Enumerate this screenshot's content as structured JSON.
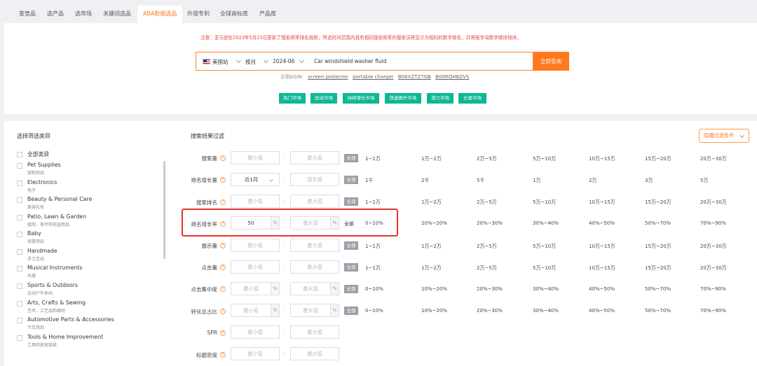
{
  "tabs": [
    {
      "label": "查竞品",
      "active": false
    },
    {
      "label": "选产品",
      "active": false
    },
    {
      "label": "选市场",
      "active": false
    },
    {
      "label": "关键词选品",
      "active": false
    },
    {
      "label": "ABA数据选品",
      "active": true
    },
    {
      "label": "外观专利",
      "active": false
    },
    {
      "label": "全球商标库",
      "active": false
    },
    {
      "label": "产品库",
      "active": false
    }
  ],
  "notice": "注意：亚马逊在2023年5月23日更新了搜索频率排名规则，所选时间范围内具有相同搜索频率的搜索词将显示为相同的数字排名，并将按字母数字顺序排序。",
  "search": {
    "site": "美国站",
    "period": "按月",
    "month": "2024-06",
    "query": "Car windshield washer fluid",
    "button": "立即查询"
  },
  "examples": {
    "label": "示例ASIN:",
    "items": [
      "screen protector",
      "portable charger",
      "B06XZTZ7GB",
      "B00RQHBZVS"
    ]
  },
  "markets": [
    "热门市场",
    "异动市场",
    "持续增长市场",
    "快速飙升市场",
    "潜力市场",
    "长尾市场"
  ],
  "categories": {
    "title": "选择筛选类目",
    "all": "全部类目",
    "items": [
      {
        "en": "Pet Supplies",
        "zh": "宠物用品"
      },
      {
        "en": "Electronics",
        "zh": "电子"
      },
      {
        "en": "Beauty & Personal Care",
        "zh": "美容化妆"
      },
      {
        "en": "Patio, Lawn & Garden",
        "zh": "庭院、草坪和花园用品"
      },
      {
        "en": "Baby",
        "zh": "母婴用品"
      },
      {
        "en": "Handmade",
        "zh": "手工艺品"
      },
      {
        "en": "Musical Instruments",
        "zh": "乐器"
      },
      {
        "en": "Sports & Outdoors",
        "zh": "运动户外休闲"
      },
      {
        "en": "Arts, Crafts & Sewing",
        "zh": "艺术、工艺品和缝纫"
      },
      {
        "en": "Automotive Parts & Accessories",
        "zh": "汽车用品"
      },
      {
        "en": "Tools & Home Improvement",
        "zh": "工具和家居装修"
      }
    ]
  },
  "filter": {
    "title": "搜索结果过滤",
    "hide_button": "隐藏过滤条件",
    "help_icon": "?",
    "min_placeholder": "最小值",
    "max_placeholder": "最大值",
    "all_label": "全部",
    "pct": "%",
    "tilde": "-",
    "rows": [
      {
        "label": "搜索量",
        "min": "",
        "pct": false,
        "options": [
          "1~1万",
          "1万~2万",
          "2万~5万",
          "5万~10万",
          "10万~15万",
          "15万~20万",
          "20万~30万"
        ]
      },
      {
        "label": "排名增长量",
        "period": "近1月",
        "growth_placeholder": "增长值",
        "options": [
          "1千",
          "2千",
          "5千",
          "1万",
          "2万",
          "3万",
          "5万"
        ]
      },
      {
        "label": "搜索排名",
        "min": "",
        "pct": false,
        "options": [
          "1~1万",
          "1万~2万",
          "2万~5万",
          "5万~10万",
          "10万~15万",
          "15万~20万",
          "20万~30万"
        ]
      },
      {
        "label": "排名增长率",
        "min": "50",
        "pct": true,
        "options": [
          "0~10%",
          "10%~20%",
          "20%~30%",
          "30%~40%",
          "40%~50%",
          "50%~70%",
          "70%~90%"
        ]
      },
      {
        "label": "展示量",
        "min": "",
        "pct": false,
        "options": [
          "1~1万",
          "1万~2万",
          "2万~5万",
          "5万~10万",
          "10万~15万",
          "15万~20万",
          "20万~30万"
        ]
      },
      {
        "label": "点击量",
        "min": "",
        "pct": false,
        "options": [
          "1~1万",
          "1万~2万",
          "2万~5万",
          "5万~10万",
          "10万~15万",
          "15万~20万",
          "20万~30万"
        ]
      },
      {
        "label": "点击集中度",
        "min": "",
        "pct": true,
        "options": [
          "0~10%",
          "10%~20%",
          "20%~30%",
          "30%~40%",
          "40%~50%",
          "50%~70%",
          "70%~90%"
        ]
      },
      {
        "label": "转化总占比",
        "min": "",
        "pct": true,
        "options": [
          "0~10%",
          "10%~20%",
          "20%~30%",
          "30%~40%",
          "40%~50%",
          "50%~70%",
          "70%~90%"
        ]
      },
      {
        "label": "SPR",
        "min": "",
        "pct": false,
        "options": []
      },
      {
        "label": "标题密度",
        "min": "",
        "pct": false,
        "options": []
      }
    ]
  },
  "colors": {
    "accent": "#ff7a1f",
    "market_button": "#0cb893",
    "notice": "#e8443a",
    "highlight_box": "#e8322c"
  }
}
